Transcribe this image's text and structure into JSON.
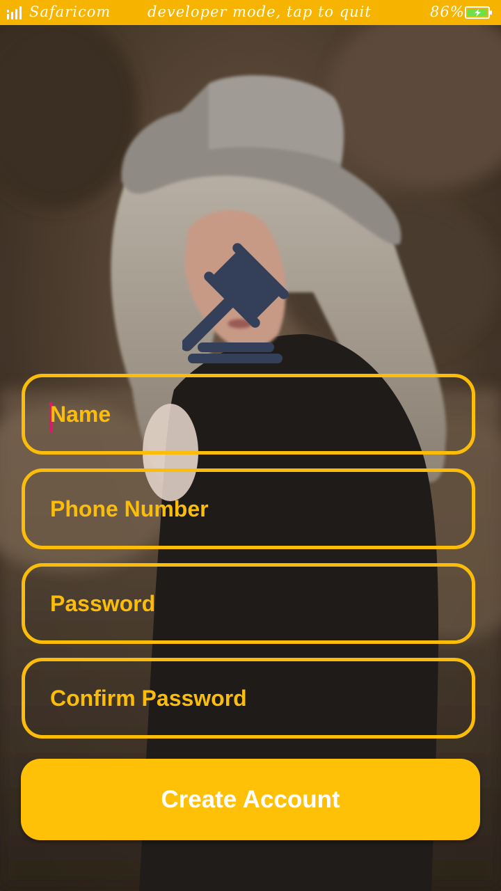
{
  "status_bar": {
    "carrier": "Safaricom",
    "notice": "developer mode, tap to quit",
    "battery": "86%",
    "signal_icon": "signal-bars-icon",
    "battery_icon": "battery-charging-icon",
    "background_color": "#f6b400"
  },
  "logo": {
    "icon": "gavel-icon",
    "color": "#34405a"
  },
  "form": {
    "name": {
      "placeholder": "Name"
    },
    "phone": {
      "placeholder": "Phone Number"
    },
    "password": {
      "placeholder": "Password"
    },
    "confirm_password": {
      "placeholder": "Confirm Password"
    },
    "accent_color": "#fbbd0a"
  },
  "create_button": {
    "label": "Create Account",
    "color": "#ffc107"
  }
}
